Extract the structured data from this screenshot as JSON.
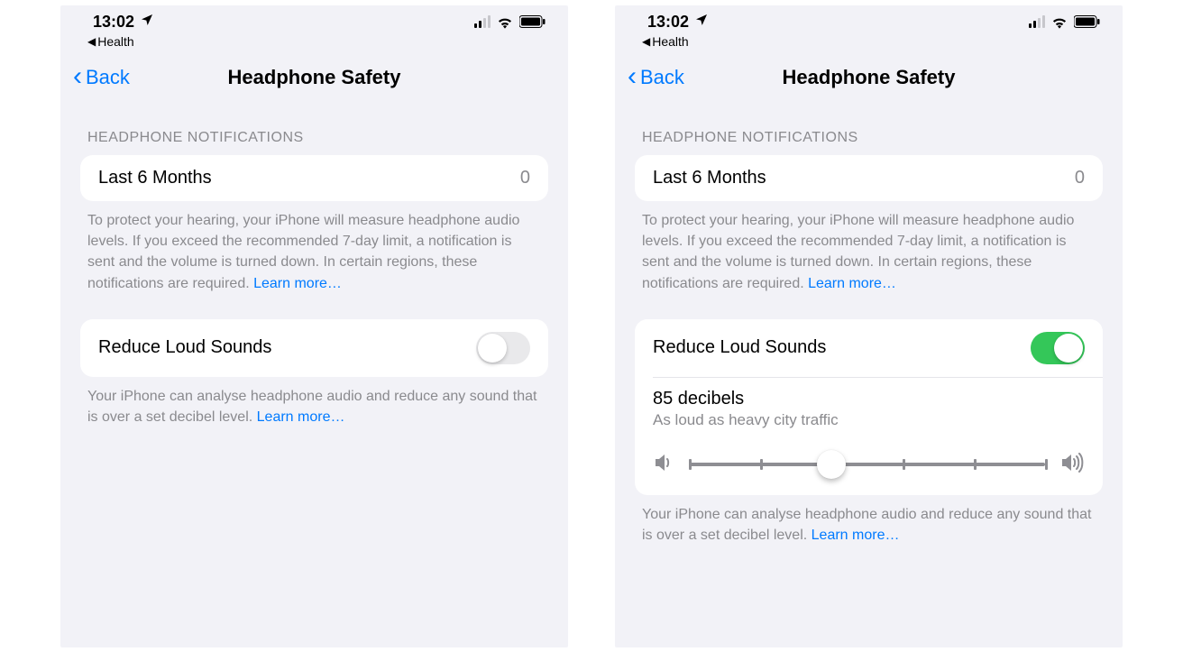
{
  "left": {
    "status": {
      "time": "13:02",
      "breadcrumb": "Health"
    },
    "nav": {
      "back": "Back",
      "title": "Headphone Safety"
    },
    "section1": {
      "header": "HEADPHONE NOTIFICATIONS",
      "row_label": "Last 6 Months",
      "row_value": "0",
      "footer": "To protect your hearing, your iPhone will measure headphone audio levels. If you exceed the recommended 7-day limit, a notification is sent and the volume is turned down. In certain regions, these notifications are required. ",
      "footer_link": "Learn more…"
    },
    "section2": {
      "row_label": "Reduce Loud Sounds",
      "toggle_on": false,
      "footer": "Your iPhone can analyse headphone audio and reduce any sound that is over a set decibel level. ",
      "footer_link": "Learn more…"
    }
  },
  "right": {
    "status": {
      "time": "13:02",
      "breadcrumb": "Health"
    },
    "nav": {
      "back": "Back",
      "title": "Headphone Safety"
    },
    "section1": {
      "header": "HEADPHONE NOTIFICATIONS",
      "row_label": "Last 6 Months",
      "row_value": "0",
      "footer": "To protect your hearing, your iPhone will measure headphone audio levels. If you exceed the recommended 7-day limit, a notification is sent and the volume is turned down. In certain regions, these notifications are required. ",
      "footer_link": "Learn more…"
    },
    "section2": {
      "row_label": "Reduce Loud Sounds",
      "toggle_on": true,
      "slider_title": "85 decibels",
      "slider_sub": "As loud as heavy city traffic",
      "slider_value_pct": 40,
      "footer": "Your iPhone can analyse headphone audio and reduce any sound that is over a set decibel level. ",
      "footer_link": "Learn more…"
    }
  }
}
